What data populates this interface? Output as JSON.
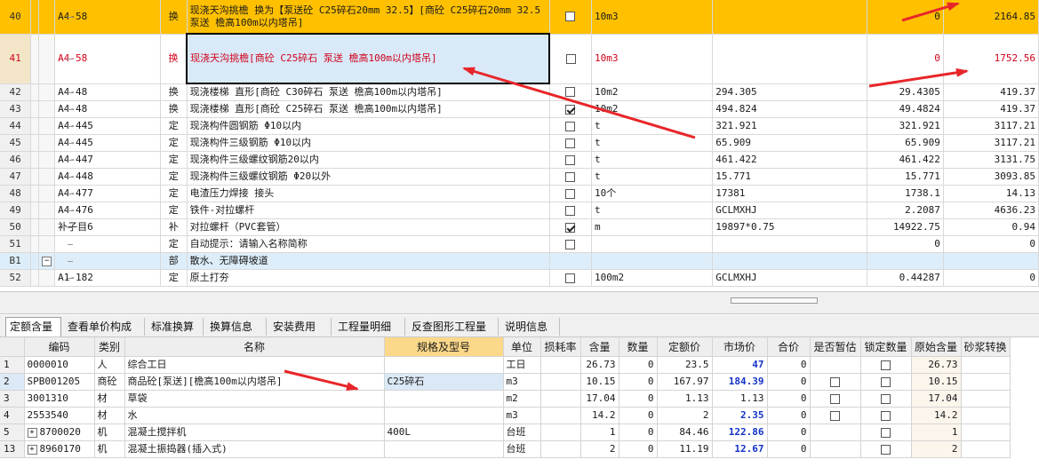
{
  "upper_rows": [
    {
      "idx": "40",
      "code": "A4-58",
      "type": "换",
      "name": "现浇天沟挑檐  换为【泵送砼 C25碎石20mm 32.5】[商砼 C25碎石20mm 32.5 泵送 檐高100m以内塔吊]",
      "checked": false,
      "unit": "10m3",
      "qty_expr": "",
      "qty": "0",
      "amount": "2164.85"
    },
    {
      "idx": "41",
      "code": "A4-58",
      "type": "换",
      "name": "现浇天沟挑檐[商砼 C25碎石 泵送 檐高100m以内塔吊]",
      "checked": false,
      "unit": "10m3",
      "qty_expr": "",
      "qty": "0",
      "amount": "1752.56"
    },
    {
      "idx": "42",
      "code": "A4-48",
      "type": "换",
      "name": "现浇楼梯 直形[商砼 C30碎石 泵送 檐高100m以内塔吊]",
      "checked": false,
      "unit": "10m2",
      "qty_expr": "294.305",
      "qty": "29.4305",
      "amount": "419.37"
    },
    {
      "idx": "43",
      "code": "A4-48",
      "type": "换",
      "name": "现浇楼梯 直形[商砼 C25碎石 泵送 檐高100m以内塔吊]",
      "checked": true,
      "unit": "10m2",
      "qty_expr": "494.824",
      "qty": "49.4824",
      "amount": "419.37"
    },
    {
      "idx": "44",
      "code": "A4-445",
      "type": "定",
      "name": "现浇构件圆钢筋 Φ10以内",
      "checked": false,
      "unit": "t",
      "qty_expr": "321.921",
      "qty": "321.921",
      "amount": "3117.21"
    },
    {
      "idx": "45",
      "code": "A4-445",
      "type": "定",
      "name": "现浇构件三级钢筋 Φ10以内",
      "checked": false,
      "unit": "t",
      "qty_expr": "65.909",
      "qty": "65.909",
      "amount": "3117.21"
    },
    {
      "idx": "46",
      "code": "A4-447",
      "type": "定",
      "name": "现浇构件三级螺纹钢筋20以内",
      "checked": false,
      "unit": "t",
      "qty_expr": "461.422",
      "qty": "461.422",
      "amount": "3131.75"
    },
    {
      "idx": "47",
      "code": "A4-448",
      "type": "定",
      "name": "现浇构件三级螺纹钢筋 Φ20以外",
      "checked": false,
      "unit": "t",
      "qty_expr": "15.771",
      "qty": "15.771",
      "amount": "3093.85"
    },
    {
      "idx": "48",
      "code": "A4-477",
      "type": "定",
      "name": "电渣压力焊接 接头",
      "checked": false,
      "unit": "10个",
      "qty_expr": "17381",
      "qty": "1738.1",
      "amount": "14.13"
    },
    {
      "idx": "49",
      "code": "A4-476",
      "type": "定",
      "name": "铁件-对拉螺杆",
      "checked": false,
      "unit": "t",
      "qty_expr": "GCLMXHJ",
      "qty": "2.2087",
      "amount": "4636.23"
    },
    {
      "idx": "50",
      "code": "补子目6",
      "type": "补",
      "name": "对拉螺杆（PVC套管）",
      "checked": true,
      "unit": "m",
      "qty_expr": "19897*0.75",
      "qty": "14922.75",
      "amount": "0.94"
    },
    {
      "idx": "51",
      "code": "",
      "type": "定",
      "name": "自动提示：请输入名称简称",
      "checked": false,
      "unit": "",
      "qty_expr": "",
      "qty": "0",
      "amount": "0"
    },
    {
      "idx": "B1",
      "code": "",
      "type": "部",
      "name": "散水、无障碍坡道",
      "checked": null,
      "unit": "",
      "qty_expr": "",
      "qty": "",
      "amount": ""
    },
    {
      "idx": "52",
      "code": "A1-182",
      "type": "定",
      "name": "原土打夯",
      "checked": false,
      "unit": "100m2",
      "qty_expr": "GCLMXHJ",
      "qty": "0.44287",
      "amount": "0"
    }
  ],
  "expander_symbol": "−",
  "tabs": [
    "定额含量",
    "查看单价构成",
    "标准换算",
    "换算信息",
    "安装费用",
    "工程量明细",
    "反查图形工程量",
    "说明信息"
  ],
  "lower": {
    "headers": [
      "",
      "编码",
      "类别",
      "名称",
      "规格及型号",
      "单位",
      "损耗率",
      "含量",
      "数量",
      "定额价",
      "市场价",
      "合价",
      "是否暂估",
      "锁定数量",
      "原始含量",
      "砂浆转换"
    ],
    "rows": [
      {
        "idx": "1",
        "plus": false,
        "code": "0000010",
        "cat": "人",
        "name": "综合工日",
        "spec": "",
        "unit": "工日",
        "loss": "",
        "content": "26.73",
        "qty": "0",
        "quota": "23.5",
        "market": "47",
        "total": "0",
        "est": null,
        "lock": false,
        "orig": "26.73"
      },
      {
        "idx": "2",
        "plus": false,
        "code": "SPB001205",
        "cat": "商砼",
        "name": "商品砼[泵送][檐高100m以内塔吊]",
        "spec": "C25碎石",
        "unit": "m3",
        "loss": "",
        "content": "10.15",
        "qty": "0",
        "quota": "167.97",
        "market": "184.39",
        "total": "0",
        "est": false,
        "lock": false,
        "orig": "10.15"
      },
      {
        "idx": "3",
        "plus": false,
        "code": "3001310",
        "cat": "材",
        "name": "草袋",
        "spec": "",
        "unit": "m2",
        "loss": "",
        "content": "17.04",
        "qty": "0",
        "quota": "1.13",
        "market": "1.13",
        "total": "0",
        "est": false,
        "lock": false,
        "orig": "17.04"
      },
      {
        "idx": "4",
        "plus": false,
        "code": "2553540",
        "cat": "材",
        "name": "水",
        "spec": "",
        "unit": "m3",
        "loss": "",
        "content": "14.2",
        "qty": "0",
        "quota": "2",
        "market": "2.35",
        "total": "0",
        "est": false,
        "lock": false,
        "orig": "14.2"
      },
      {
        "idx": "5",
        "plus": true,
        "code": "8700020",
        "cat": "机",
        "name": "混凝土搅拌机",
        "spec": "400L",
        "unit": "台班",
        "loss": "",
        "content": "1",
        "qty": "0",
        "quota": "84.46",
        "market": "122.86",
        "total": "0",
        "est": null,
        "lock": false,
        "orig": "1"
      },
      {
        "idx": "13",
        "plus": true,
        "code": "8960170",
        "cat": "机",
        "name": "混凝土振捣器(插入式)",
        "spec": "",
        "unit": "台班",
        "loss": "",
        "content": "2",
        "qty": "0",
        "quota": "11.19",
        "market": "12.67",
        "total": "0",
        "est": null,
        "lock": false,
        "orig": "2"
      }
    ],
    "plus_symbol": "+"
  },
  "annotation_color": "#e8262a"
}
